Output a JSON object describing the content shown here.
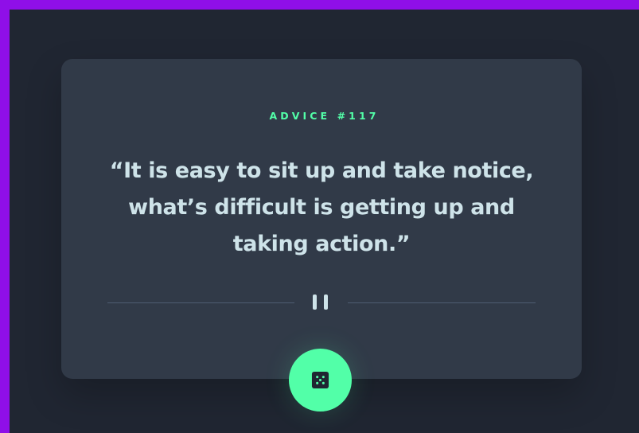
{
  "advice": {
    "label": "ADVICE #117",
    "quote": "“It is easy to sit up and take notice, what’s difficult is getting up and taking action.”"
  },
  "divider": {
    "icon": "pause-icon"
  },
  "action_button": {
    "icon": "dice-icon"
  },
  "colors": {
    "frame": "#8f0fe8",
    "background": "#202632",
    "card": "#313a48",
    "accent": "#52ffa8",
    "text": "#cee3e9",
    "divider": "#4f5d73"
  }
}
